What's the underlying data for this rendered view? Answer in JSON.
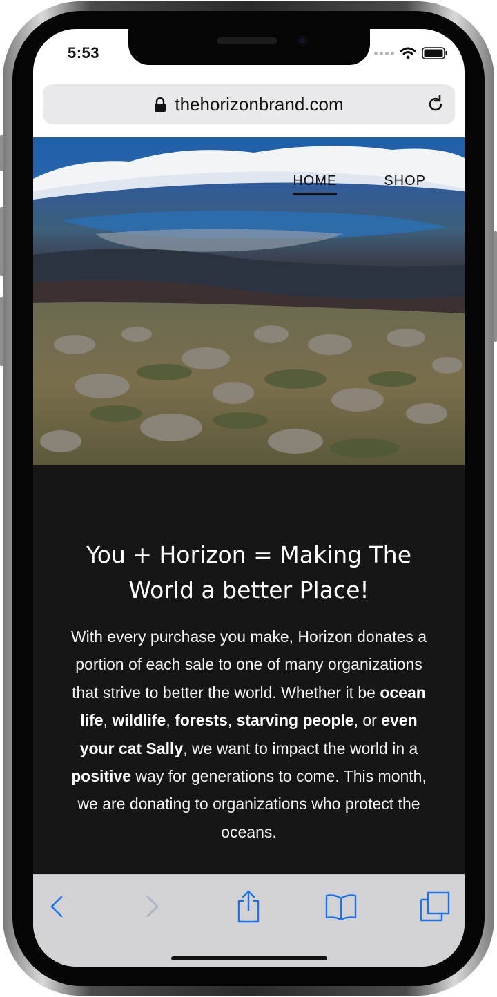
{
  "status_bar": {
    "time": "5:53"
  },
  "browser": {
    "url": "thehorizonbrand.com"
  },
  "site_nav": {
    "items": [
      {
        "label": "HOME",
        "active": true
      },
      {
        "label": "SHOP",
        "active": false
      }
    ]
  },
  "content": {
    "headline_line1": "You + Horizon = Making The",
    "headline_line2": "World a better Place!",
    "body": {
      "t1": "With every purchase you make, Horizon donates a portion of each sale to one of many organizations that strive to better the world. Whether it be ",
      "b1": "ocean life",
      "t2": ", ",
      "b2": "wildlife",
      "t3": ", ",
      "b3": "forests",
      "t4": ", ",
      "b4": "starving people",
      "t5": ", or ",
      "b5": "even your cat Sally",
      "t6": ", we want to impact the world in a ",
      "b6": "positive",
      "t7": " way for generations to come. This month, we are donating to organizations who protect the oceans."
    }
  },
  "toolbar": {
    "icons": [
      "back-icon",
      "forward-icon",
      "share-icon",
      "bookmarks-icon",
      "tabs-icon"
    ]
  },
  "colors": {
    "accent_blue": "#1a73e8",
    "content_bg": "#161616",
    "toolbar_bg": "#d2d2d4"
  }
}
